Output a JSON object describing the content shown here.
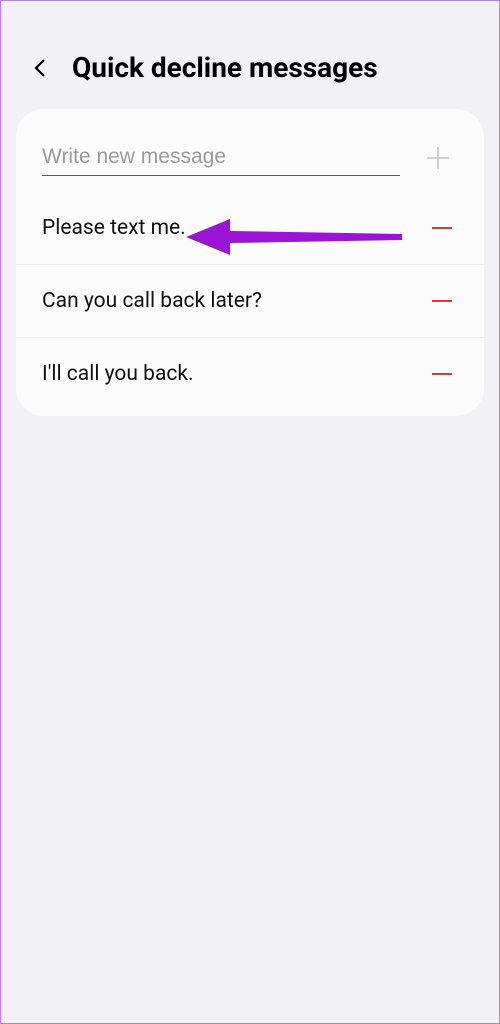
{
  "header": {
    "title": "Quick decline messages"
  },
  "input": {
    "placeholder": "Write new message"
  },
  "messages": [
    {
      "text": "Please text me."
    },
    {
      "text": "Can you call back later?"
    },
    {
      "text": "I'll call you back."
    }
  ],
  "annotation": {
    "arrow_color": "#9b14d6"
  }
}
